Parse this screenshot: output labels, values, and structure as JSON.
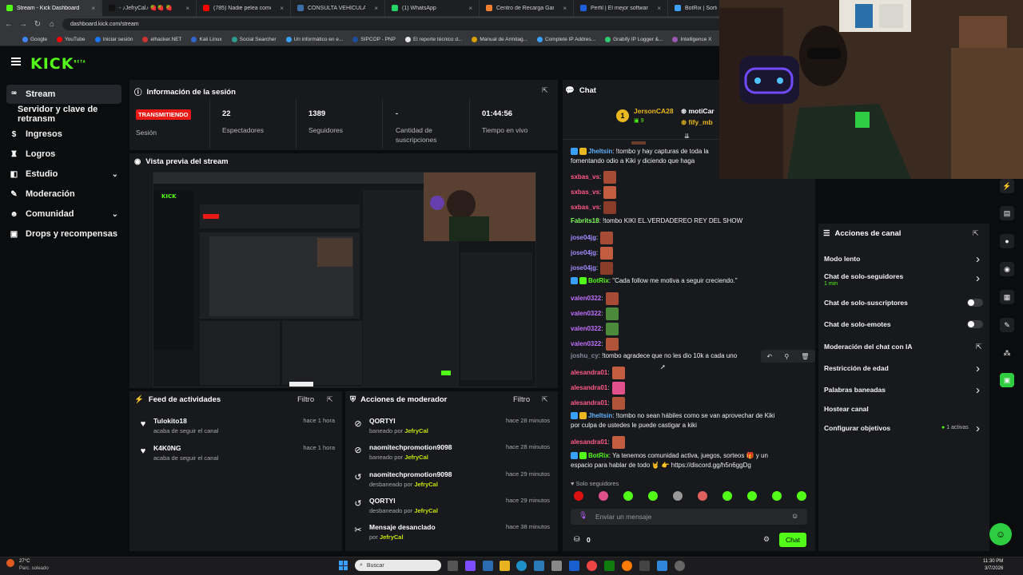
{
  "browser": {
    "tabs": [
      {
        "label": "Stream - Kick Dashboard",
        "color": "#53fc18"
      },
      {
        "label": "- ♪JefryCal♪ 🍓🍓 🍓",
        "color": "#111111"
      },
      {
        "label": "(785) Nadie pelea como el M",
        "color": "#ff0000"
      },
      {
        "label": "CONSULTA VEHICULAR",
        "color": "#3a6ea5"
      },
      {
        "label": "(1) WhatsApp",
        "color": "#25d366"
      },
      {
        "label": "Centro de Recarga Garena",
        "color": "#f08030"
      },
      {
        "label": "Perfil | El mejor software para",
        "color": "#2060e0"
      },
      {
        "label": "BotRix | Sorteos",
        "color": "#3fa0ff"
      }
    ],
    "url": "dashboard.kick.com/stream",
    "bookmarks": [
      "Google",
      "YouTube",
      "Iniciar sesión",
      "elhacker.NET",
      "Kali Linux",
      "Social Searcher",
      "Un informático en e...",
      "SIPCOP - PNP",
      "El reporte técnico d...",
      "Manual de Armitag...",
      "Complete IP Addres...",
      "Grabify IP Logger &...",
      "Intelligence X",
      "Online investigation..."
    ]
  },
  "logo": {
    "text": "KICK",
    "tag": "BETA"
  },
  "sidebar": {
    "items": [
      {
        "label": "Stream"
      },
      {
        "label": "Servidor y clave de retransm"
      },
      {
        "label": "Ingresos"
      },
      {
        "label": "Logros"
      },
      {
        "label": "Estudio"
      },
      {
        "label": "Moderación"
      },
      {
        "label": "Comunidad"
      },
      {
        "label": "Drops y recompensas"
      }
    ]
  },
  "session": {
    "title": "Información de la sesión",
    "badge": "TRANSMITIENDO",
    "badge_label": "Sesión",
    "stats": [
      {
        "value": "22",
        "label": "Espectadores"
      },
      {
        "value": "1389",
        "label": "Seguidores"
      },
      {
        "value": "-",
        "label": "Cantidad de suscripciones"
      },
      {
        "value": "01:44:56",
        "label": "Tiempo en vivo"
      }
    ]
  },
  "preview": {
    "title": "Vista previa del stream"
  },
  "activity": {
    "title": "Feed de actividades",
    "filter": "Filtro",
    "items": [
      {
        "name": "Tulokito18",
        "sub": "acaba de seguir el canal",
        "time": "hace 1 hora"
      },
      {
        "name": "K4K0NG",
        "sub": "acaba de seguir el canal",
        "time": "hace 1 hora"
      }
    ]
  },
  "modactions": {
    "title": "Acciones de moderador",
    "filter": "Filtro",
    "items": [
      {
        "name": "QORTYI",
        "action": "baneado por",
        "by": "JefryCal",
        "time": "hace 28 minutos",
        "icon": "⊘"
      },
      {
        "name": "naomitechpromotion9098",
        "action": "baneado por",
        "by": "JefryCal",
        "time": "hace 28 minutos",
        "icon": "⊘"
      },
      {
        "name": "naomitechpromotion9098",
        "action": "desbaneado por",
        "by": "JefryCal",
        "time": "hace 29 minutos",
        "icon": "↺"
      },
      {
        "name": "QORTYI",
        "action": "desbaneado por",
        "by": "JefryCal",
        "time": "hace 29 minutos",
        "icon": "↺"
      },
      {
        "name": "Mensaje desanclado",
        "action": "por",
        "by": "JefryCal",
        "time": "hace 38 minutos",
        "icon": "✂"
      }
    ]
  },
  "chat": {
    "title": "Chat",
    "top_user1": "JersonCA28",
    "top_user1_count": "9",
    "top_user2": "motiCar",
    "top_user3": "fify_mb",
    "rank": "1",
    "messages": [
      {
        "user": "Jheltsin",
        "color": "#5fb3ff",
        "text": ": !tombo y hay capturas de toda la",
        "line2": "fomentando odio a Kiki y diciendo que haga",
        "emotes": 0
      },
      {
        "user": "sxbas_vs",
        "color": "#ff5a8a",
        "text": ":",
        "emotes": 1
      },
      {
        "user": "sxbas_vs",
        "color": "#ff5a8a",
        "text": ":",
        "emotes": 1
      },
      {
        "user": "sxbas_vs",
        "color": "#ff5a8a",
        "text": ":",
        "emotes": 1
      },
      {
        "user": "Fabrits18",
        "color": "#7cff5a",
        "text": ": !tombo KIKI EL.VERDADEREO REY DEL SHOW",
        "emotes": 0
      },
      {
        "user": "jose04jg",
        "color": "#a08cff",
        "text": ":",
        "emotes": 1
      },
      {
        "user": "jose04jg",
        "color": "#a08cff",
        "text": ":",
        "emotes": 1
      },
      {
        "user": "jose04jg",
        "color": "#a08cff",
        "text": ":",
        "emotes": 1
      },
      {
        "user": "BotRix",
        "color": "#53fc18",
        "text": ": \"Cada follow me motiva a seguir creciendo.\"",
        "emotes": 0
      },
      {
        "user": "valen0322",
        "color": "#c070ff",
        "text": ":",
        "emotes": 1
      },
      {
        "user": "valen0322",
        "color": "#c070ff",
        "text": ":",
        "emotes": 1
      },
      {
        "user": "valen0322",
        "color": "#c070ff",
        "text": ":",
        "emotes": 1
      },
      {
        "user": "valen0322",
        "color": "#c070ff",
        "text": ":",
        "emotes": 1
      },
      {
        "user": "joshu_cy",
        "color": "#8a8aa0",
        "text": ": !tombo agradece que no les dio 10k a cada uno",
        "emotes": 0
      },
      {
        "user": "alesandra01",
        "color": "#ff5a8a",
        "text": ":",
        "emotes": 1
      },
      {
        "user": "alesandra01",
        "color": "#ff5a8a",
        "text": ":",
        "emotes": 1
      },
      {
        "user": "alesandra01",
        "color": "#ff5a8a",
        "text": ":",
        "emotes": 1
      },
      {
        "user": "Jheltsin",
        "color": "#5fb3ff",
        "text": ": !tombo no sean hábiles como se van aprovechar de Kiki",
        "line2": "por culpa de ustedes le puede castigar a kiki",
        "emotes": 0
      },
      {
        "user": "alesandra01",
        "color": "#ff5a8a",
        "text": ":",
        "emotes": 1
      },
      {
        "user": "BotRix",
        "color": "#53fc18",
        "text": ": Ya tenemos comunidad activa, juegos, sorteos 🎁 y un",
        "line2": "espacio para hablar de todo 🤘 👉 https://discord.gg/h5n6ggDg",
        "emotes": 0
      }
    ],
    "followers_only": "Solo seguidores",
    "input_placeholder": "Enviar un mensaje",
    "points": "0",
    "send": "Chat"
  },
  "channel_actions": {
    "title": "Acciones de canal",
    "items": [
      {
        "label": "Modo lento",
        "control": "arrow"
      },
      {
        "label": "Chat de solo-seguidores",
        "sub": "1 min",
        "control": "arrow"
      },
      {
        "label": "Chat de solo-suscriptores",
        "control": "toggle"
      },
      {
        "label": "Chat de solo-emotes",
        "control": "toggle"
      },
      {
        "label": "Moderación del chat con IA",
        "control": "link"
      },
      {
        "label": "Restricción de edad",
        "control": "arrow"
      },
      {
        "label": "Palabras baneadas",
        "control": "arrow"
      },
      {
        "label": "Hostear canal",
        "control": "none"
      },
      {
        "label": "Configurar objetivos",
        "sub_right": "1 activas",
        "control": "arrow"
      }
    ]
  },
  "taskbar": {
    "weather_temp": "27°C",
    "weather_desc": "Parc. soleado",
    "search": "Buscar",
    "time": "11:30 PM",
    "date": "3/7/2026"
  }
}
